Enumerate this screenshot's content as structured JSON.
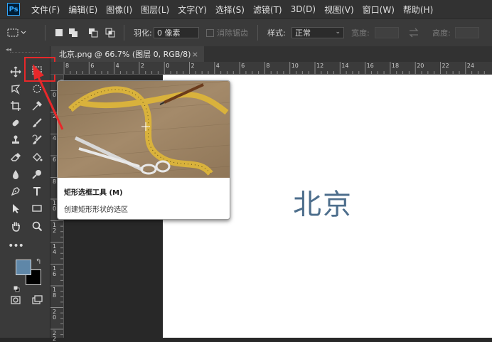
{
  "app": {
    "logo_text": "Ps"
  },
  "menu": [
    {
      "label": "文件(F)"
    },
    {
      "label": "编辑(E)"
    },
    {
      "label": "图像(I)"
    },
    {
      "label": "图层(L)"
    },
    {
      "label": "文字(Y)"
    },
    {
      "label": "选择(S)"
    },
    {
      "label": "滤镜(T)"
    },
    {
      "label": "3D(D)"
    },
    {
      "label": "视图(V)"
    },
    {
      "label": "窗口(W)"
    },
    {
      "label": "帮助(H)"
    }
  ],
  "options_bar": {
    "feather_label": "羽化:",
    "feather_value": "0 像素",
    "antialias_label": "消除锯齿",
    "style_label": "样式:",
    "style_value": "正常",
    "width_label": "宽度:",
    "height_label": "高度:"
  },
  "document": {
    "tab_title": "北京.png @ 66.7% (图层 0, RGB/8)",
    "tab_close": "×",
    "canvas_text": "北京",
    "hruler_labels": [
      "8",
      "6",
      "4",
      "2",
      "0",
      "2",
      "4",
      "6",
      "8",
      "10",
      "12",
      "14",
      "16",
      "18",
      "20",
      "22",
      "24"
    ],
    "vruler_labels": [
      "2",
      "0",
      "2",
      "4",
      "6",
      "8",
      "1\n0",
      "1\n2",
      "1\n4",
      "1\n6",
      "1\n8",
      "2\n0",
      "2\n2"
    ]
  },
  "tooltip": {
    "title": "矩形选框工具 (M)",
    "description": "创建矩形形状的选区"
  },
  "colors": {
    "foreground": "#5f87a8",
    "background": "#000000",
    "highlight": "#e8282a",
    "canvas_text": "#4d6e8c"
  }
}
